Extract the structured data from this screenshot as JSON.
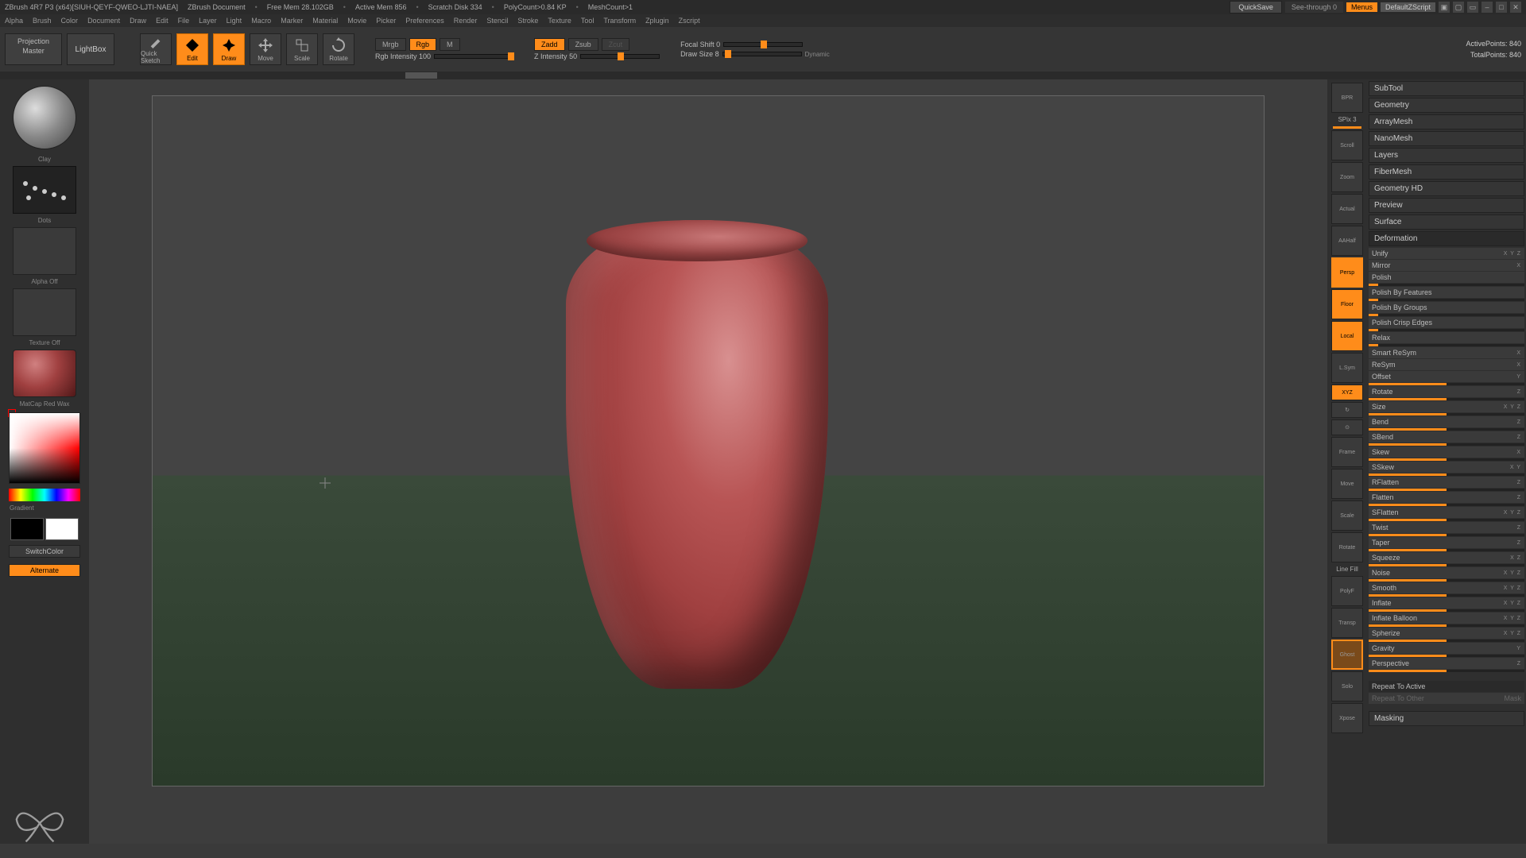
{
  "titlebar": {
    "app": "ZBrush 4R7 P3 (x64)[SIUH-QEYF-QWEO-LJTI-NAEA]",
    "document": "ZBrush Document",
    "free_mem": "Free Mem 28.102GB",
    "active_mem": "Active Mem 856",
    "scratch": "Scratch Disk 334",
    "polycount": "PolyCount>0.84 KP",
    "meshcount": "MeshCount>1",
    "quicksave": "QuickSave",
    "seethrough": "See-through  0",
    "menus": "Menus",
    "default_script": "DefaultZScript"
  },
  "menu": [
    "Alpha",
    "Brush",
    "Color",
    "Document",
    "Draw",
    "Edit",
    "File",
    "Layer",
    "Light",
    "Macro",
    "Marker",
    "Material",
    "Movie",
    "Picker",
    "Preferences",
    "Render",
    "Stencil",
    "Stroke",
    "Texture",
    "Tool",
    "Transform",
    "Zplugin",
    "Zscript"
  ],
  "toolbar": {
    "projection": "Projection Master",
    "lightbox": "LightBox",
    "quicksketch": "Quick Sketch",
    "edit": "Edit",
    "draw": "Draw",
    "move": "Move",
    "scale": "Scale",
    "rotate": "Rotate",
    "mrgb": "Mrgb",
    "rgb": "Rgb",
    "m": "M",
    "rgb_intensity": "Rgb Intensity 100",
    "zadd": "Zadd",
    "zsub": "Zsub",
    "zcut": "Zcut",
    "z_intensity": "Z Intensity 50",
    "focal": "Focal Shift 0",
    "draw_size": "Draw Size 8",
    "dynamic": "Dynamic",
    "active_points": "ActivePoints: 840",
    "total_points": "TotalPoints: 840"
  },
  "left": {
    "brush": "Clay",
    "stroke": "Dots",
    "alpha": "Alpha  Off",
    "texture": "Texture  Off",
    "material": "MatCap Red Wax",
    "gradient": "Gradient",
    "switchcolor": "SwitchColor",
    "alternate": "Alternate"
  },
  "right_tools": {
    "spix": "SPix 3",
    "items": [
      "BPR",
      "Scroll",
      "Zoom",
      "Actual",
      "AAHalf",
      "Persp",
      "Floor",
      "Local",
      "L.Sym",
      "XYZ",
      "",
      "",
      "Frame",
      "Move",
      "Scale",
      "Rotate",
      "Line Fill",
      "PolyF",
      "Transp",
      "Ghost",
      "Solo",
      "Xpose"
    ]
  },
  "panel": {
    "sections": [
      "SubTool",
      "Geometry",
      "ArrayMesh",
      "NanoMesh",
      "Layers",
      "FiberMesh",
      "Geometry HD",
      "Preview",
      "Surface"
    ],
    "deformation": "Deformation",
    "deform_items": [
      {
        "label": "Unify",
        "axis": "X Y Z"
      },
      {
        "label": "Mirror",
        "axis": "X"
      },
      {
        "label": "Polish",
        "axis": ""
      },
      {
        "label": "Polish By Features",
        "axis": ""
      },
      {
        "label": "Polish By Groups",
        "axis": ""
      },
      {
        "label": "Polish Crisp Edges",
        "axis": ""
      },
      {
        "label": "Relax",
        "axis": ""
      },
      {
        "label": "Smart ReSym",
        "axis": "X"
      },
      {
        "label": "ReSym",
        "axis": "X"
      },
      {
        "label": "Offset",
        "axis": "Y"
      },
      {
        "label": "Rotate",
        "axis": "Z"
      },
      {
        "label": "Size",
        "axis": "X Y Z"
      },
      {
        "label": "Bend",
        "axis": "Z"
      },
      {
        "label": "SBend",
        "axis": "Z"
      },
      {
        "label": "Skew",
        "axis": "X"
      },
      {
        "label": "SSkew",
        "axis": "X Y"
      },
      {
        "label": "RFlatten",
        "axis": "Z"
      },
      {
        "label": "Flatten",
        "axis": "Z"
      },
      {
        "label": "SFlatten",
        "axis": "X Y Z"
      },
      {
        "label": "Twist",
        "axis": "Z"
      },
      {
        "label": "Taper",
        "axis": "Z"
      },
      {
        "label": "Squeeze",
        "axis": "X  Z"
      },
      {
        "label": "Noise",
        "axis": "X Y Z"
      },
      {
        "label": "Smooth",
        "axis": "X Y Z"
      },
      {
        "label": "Inflate",
        "axis": "X Y Z"
      },
      {
        "label": "Inflate Balloon",
        "axis": "X Y Z"
      },
      {
        "label": "Spherize",
        "axis": "X Y Z"
      },
      {
        "label": "Gravity",
        "axis": "Y"
      },
      {
        "label": "Perspective",
        "axis": "Z"
      }
    ],
    "repeat_active": "Repeat To Active",
    "repeat_other": "Repeat To Other",
    "mask": "Mask",
    "masking": "Masking"
  }
}
